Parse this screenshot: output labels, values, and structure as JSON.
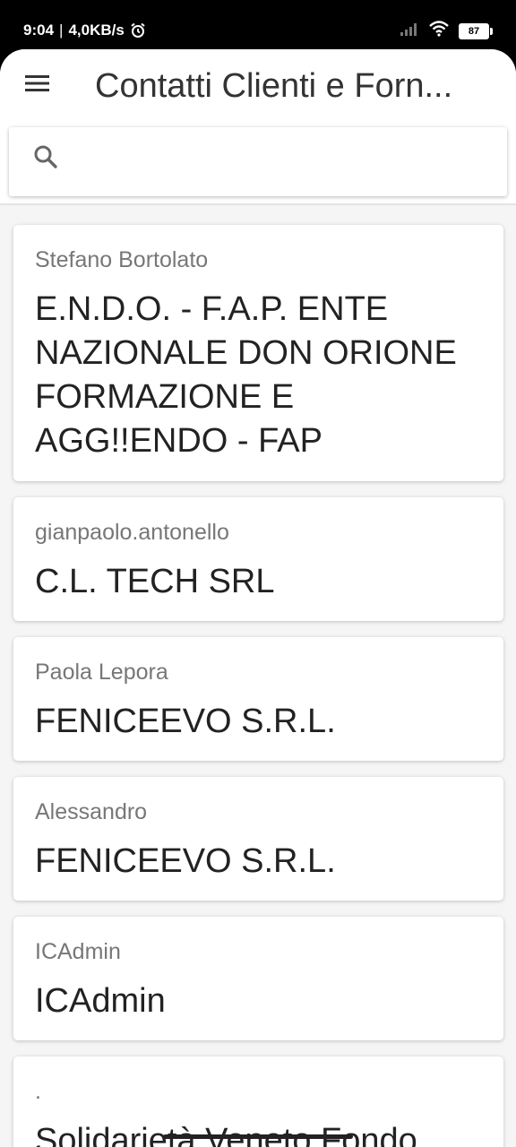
{
  "status_bar": {
    "time": "9:04",
    "separator": "|",
    "network_speed": "4,0KB/s",
    "battery_level": "87",
    "icons": [
      "alarm-icon",
      "signal-icon",
      "wifi-icon",
      "battery-icon"
    ]
  },
  "header": {
    "title": "Contatti Clienti e Forn...",
    "menu_icon": "menu-icon"
  },
  "search": {
    "icon": "search-icon",
    "placeholder": "",
    "value": ""
  },
  "contacts": [
    {
      "contact": "Stefano Bortolato",
      "company": "E.N.D.O. - F.A.P. ENTE NAZIONALE DON ORIONE FORMAZIONE E AGG!!ENDO - FAP"
    },
    {
      "contact": "gianpaolo.antonello",
      "company": "C.L. TECH SRL"
    },
    {
      "contact": "Paola Lepora",
      "company": "FENICEEVO S.R.L."
    },
    {
      "contact": "Alessandro",
      "company": "FENICEEVO S.R.L."
    },
    {
      "contact": "ICAdmin",
      "company": "ICAdmin"
    },
    {
      "contact": ".",
      "company": "Solidarietà Veneto Fondo"
    }
  ],
  "colors": {
    "status_bar_bg": "#000000",
    "surface": "#ffffff",
    "list_bg": "#f5f5f5",
    "title_text": "#333333",
    "contact_text": "#777777",
    "company_text": "#222222"
  }
}
